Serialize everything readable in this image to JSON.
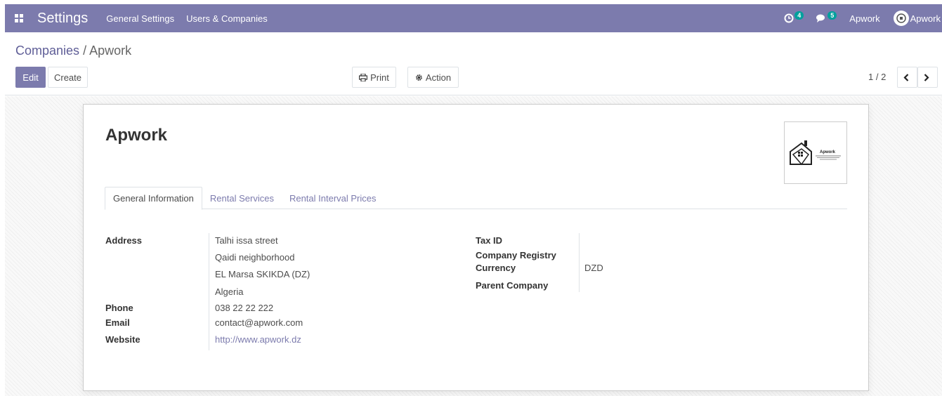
{
  "navbar": {
    "app_title": "Settings",
    "menus": [
      "General Settings",
      "Users & Companies"
    ],
    "activity_count": "4",
    "messages_count": "5",
    "company_switcher": "Apwork",
    "user_name": "Apwork",
    "accent": "#7c7bad"
  },
  "control_panel": {
    "breadcrumb_parent": "Companies",
    "breadcrumb_sep": "/",
    "breadcrumb_current": "Apwork",
    "edit_label": "Edit",
    "create_label": "Create",
    "print_label": "Print",
    "action_label": "Action",
    "pager": "1 / 2"
  },
  "form": {
    "company_name": "Apwork",
    "logo_text": "Apwork",
    "tabs": [
      "General Information",
      "Rental Services",
      "Rental Interval Prices"
    ],
    "left": {
      "address_label": "Address",
      "address_lines": [
        "Talhi issa street",
        "Qaidi neighborhood",
        "EL Marsa  SKIKDA (DZ)",
        "Algeria"
      ],
      "phone_label": "Phone",
      "phone": "038 22 22 222",
      "email_label": "Email",
      "email": "contact@apwork.com",
      "website_label": "Website",
      "website": "http://www.apwork.dz"
    },
    "right": {
      "tax_id_label": "Tax ID",
      "registry_label": "Company Registry",
      "currency_label": "Currency",
      "currency": "DZD",
      "parent_label": "Parent Company"
    }
  }
}
